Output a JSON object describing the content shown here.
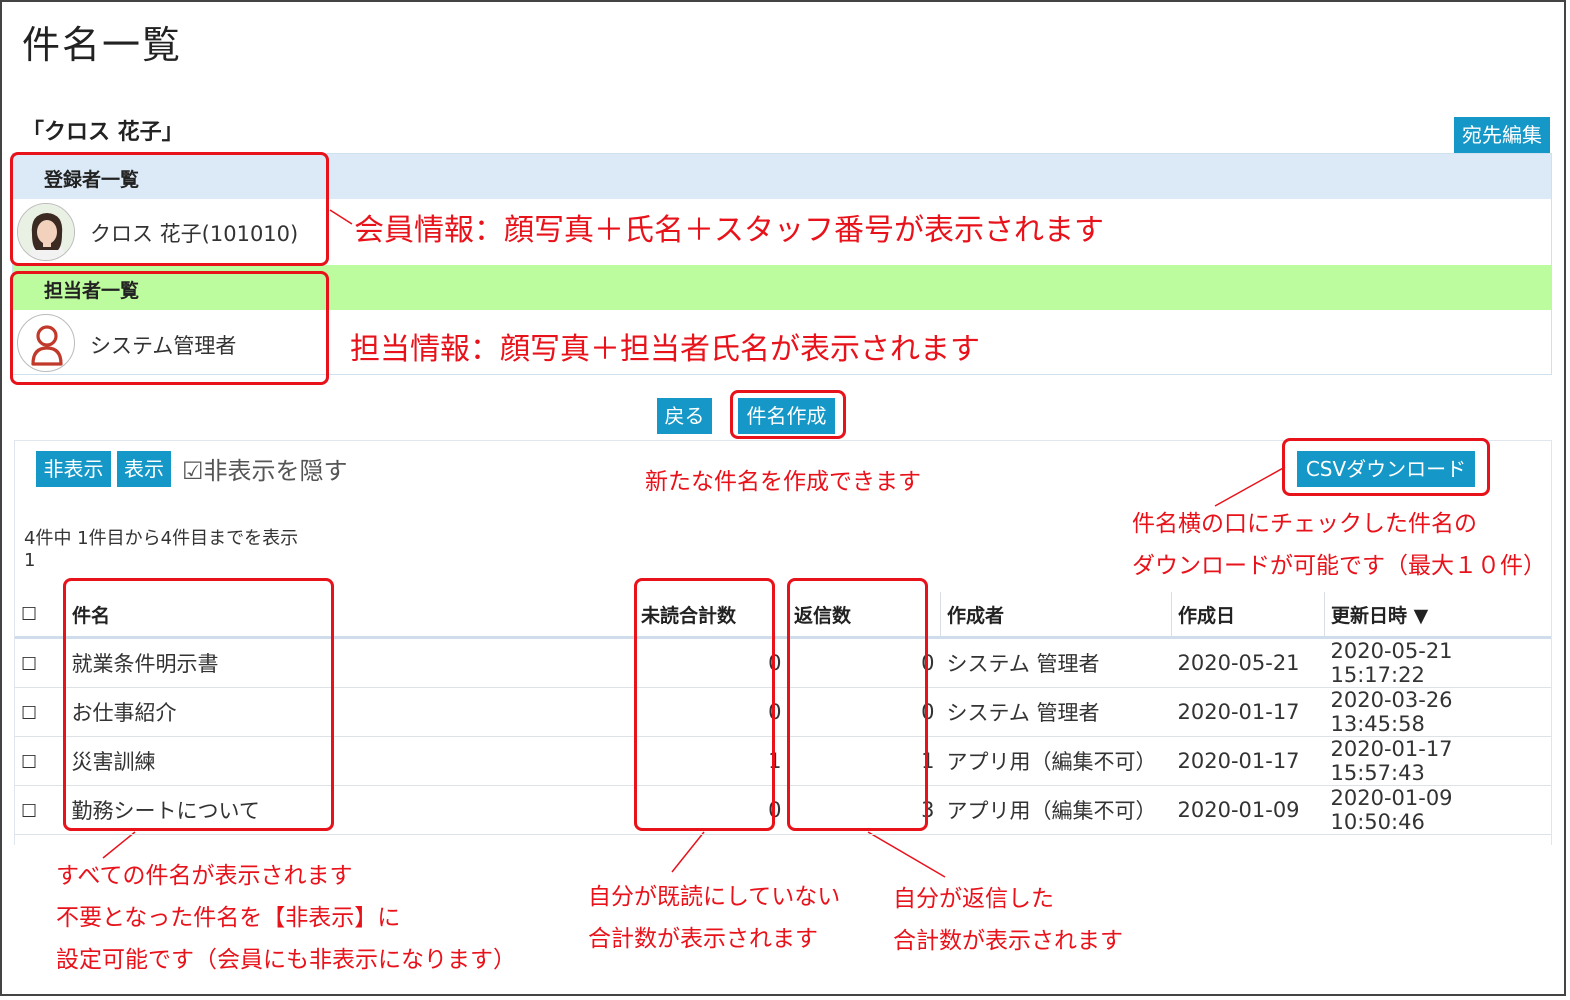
{
  "page": {
    "title": "件名一覧",
    "member_display": "「クロス 花子」",
    "edit_recipients_label": "宛先編集"
  },
  "registrants": {
    "header": "登録者一覧",
    "name": "クロス 花子(101010)"
  },
  "assignees": {
    "header": "担当者一覧",
    "name": "システム管理者"
  },
  "actions": {
    "back_label": "戻る",
    "create_subject_label": "件名作成"
  },
  "list_controls": {
    "hide_label": "非表示",
    "show_label": "表示",
    "hide_hidden_label": "☑非表示を隠す",
    "csv_label": "CSVダウンロード",
    "count_text": "4件中 1件目から4件目までを表示",
    "page_number": "1"
  },
  "table": {
    "columns": [
      "件名",
      "未読合計数",
      "返信数",
      "作成者",
      "作成日",
      "更新日時 ▼"
    ],
    "rows": [
      {
        "subject": "就業条件明示書",
        "unread": "0",
        "replies": "0",
        "creator": "システム 管理者",
        "created": "2020-05-21",
        "updated": "2020-05-21 15:17:22"
      },
      {
        "subject": "お仕事紹介",
        "unread": "0",
        "replies": "0",
        "creator": "システム 管理者",
        "created": "2020-01-17",
        "updated": "2020-03-26 13:45:58"
      },
      {
        "subject": "災害訓練",
        "unread": "1",
        "replies": "1",
        "creator": "アプリ用（編集不可）",
        "created": "2020-01-17",
        "updated": "2020-01-17 15:57:43"
      },
      {
        "subject": "勤務シートについて",
        "unread": "0",
        "replies": "3",
        "creator": "アプリ用（編集不可）",
        "created": "2020-01-09",
        "updated": "2020-01-09 10:50:46"
      }
    ]
  },
  "annotations": {
    "member_info": "会員情報：顔写真＋氏名＋スタッフ番号が表示されます",
    "assignee_info": "担当情報：顔写真＋担当者氏名が表示されます",
    "create_note": "新たな件名を作成できます",
    "csv_note_1": "件名横の口にチェックした件名の",
    "csv_note_2": "ダウンロードが可能です（最大１０件）",
    "subject_note_1": "すべての件名が表示されます",
    "subject_note_2": "不要となった件名を【非表示】に",
    "subject_note_3": "設定可能です（会員にも非表示になります）",
    "unread_note_1": "自分が既読にしていない",
    "unread_note_2": "合計数が表示されます",
    "reply_note_1": "自分が返信した",
    "reply_note_2": "合計数が表示されます"
  },
  "colors": {
    "accent_button": "#1598c7",
    "annotation_red": "#e8121b",
    "registrant_band": "#dce9f7",
    "assignee_band": "#bdfc9e"
  },
  "icons": {
    "member_avatar": "member-photo-icon",
    "assignee_avatar": "person-outline-icon",
    "checkbox": "checkbox-icon"
  }
}
